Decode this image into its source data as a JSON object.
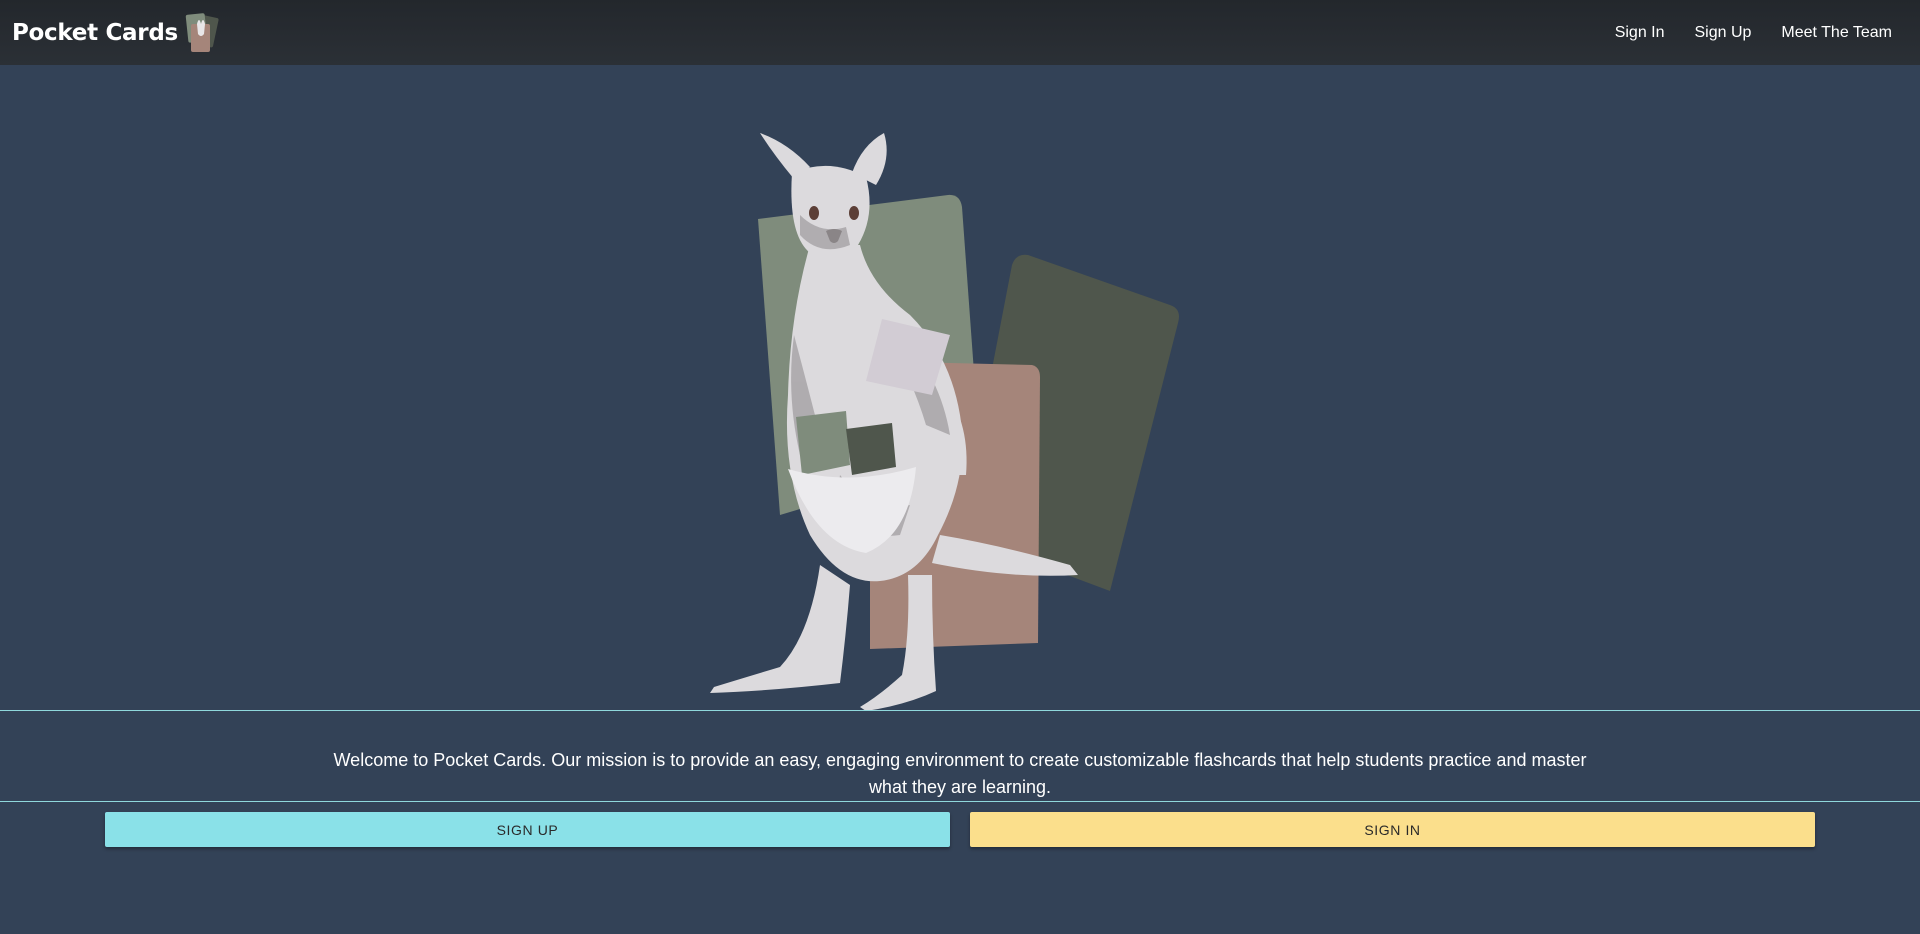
{
  "navbar": {
    "brand": "Pocket Cards",
    "links": [
      "Sign In",
      "Sign Up",
      "Meet The Team"
    ]
  },
  "hero": {
    "image_subject": "kangaroo-with-flashcards"
  },
  "mission": {
    "text": "Welcome to Pocket Cards. Our mission is to provide an easy, engaging environment to create customizable flashcards that help students practice and master what they are learning."
  },
  "actions": {
    "sign_up": "SIGN UP",
    "sign_in": "SIGN IN"
  },
  "colors": {
    "background": "#334257",
    "navbar": "#26292e",
    "accent_teal": "#8ae1e8",
    "accent_yellow": "#fbdf8c",
    "card_green": "#7f8c7c",
    "card_dark_green": "#4f564c",
    "card_tan": "#a5857a"
  }
}
